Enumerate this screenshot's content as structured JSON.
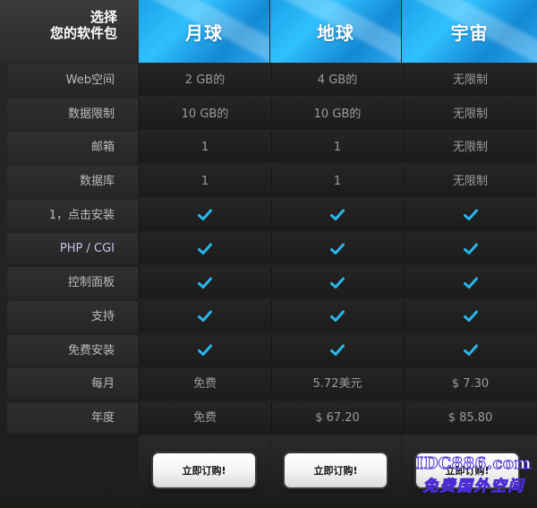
{
  "header": {
    "title_line1": "选择",
    "title_line2": "您的软件包",
    "plans": [
      "月球",
      "地球",
      "宇宙"
    ]
  },
  "rows": [
    {
      "label": "Web空间",
      "values": [
        "2 GB的",
        "4 GB的",
        "无限制"
      ]
    },
    {
      "label": "数据限制",
      "values": [
        "10 GB的",
        "10 GB的",
        "无限制"
      ]
    },
    {
      "label": "邮箱",
      "values": [
        "1",
        "1",
        "无限制"
      ]
    },
    {
      "label": "数据库",
      "values": [
        "1",
        "1",
        "无限制"
      ]
    },
    {
      "label": "1，点击安装",
      "values": [
        "check",
        "check",
        "check"
      ]
    },
    {
      "label": "PHP / CGI",
      "values": [
        "check",
        "check",
        "check"
      ]
    },
    {
      "label": "控制面板",
      "values": [
        "check",
        "check",
        "check"
      ]
    },
    {
      "label": "支持",
      "values": [
        "check",
        "check",
        "check"
      ]
    },
    {
      "label": "免费安装",
      "values": [
        "check",
        "check",
        "check"
      ]
    },
    {
      "label": "每月",
      "values": [
        "免费",
        "5.72美元",
        "$ 7.30"
      ]
    },
    {
      "label": "年度",
      "values": [
        "免费",
        "$ 67.20",
        "$ 85.80"
      ]
    }
  ],
  "order_button_label": "立即订购!",
  "watermark": {
    "line1": "IDC886.com",
    "line2": "免费国外空间"
  },
  "colors": {
    "accent": "#2fc0ff",
    "check": "#29b6ea",
    "label_text": "#bdbdbd",
    "cell_text": "#9c9c9c"
  },
  "icons": {
    "check": "checkmark-icon"
  }
}
